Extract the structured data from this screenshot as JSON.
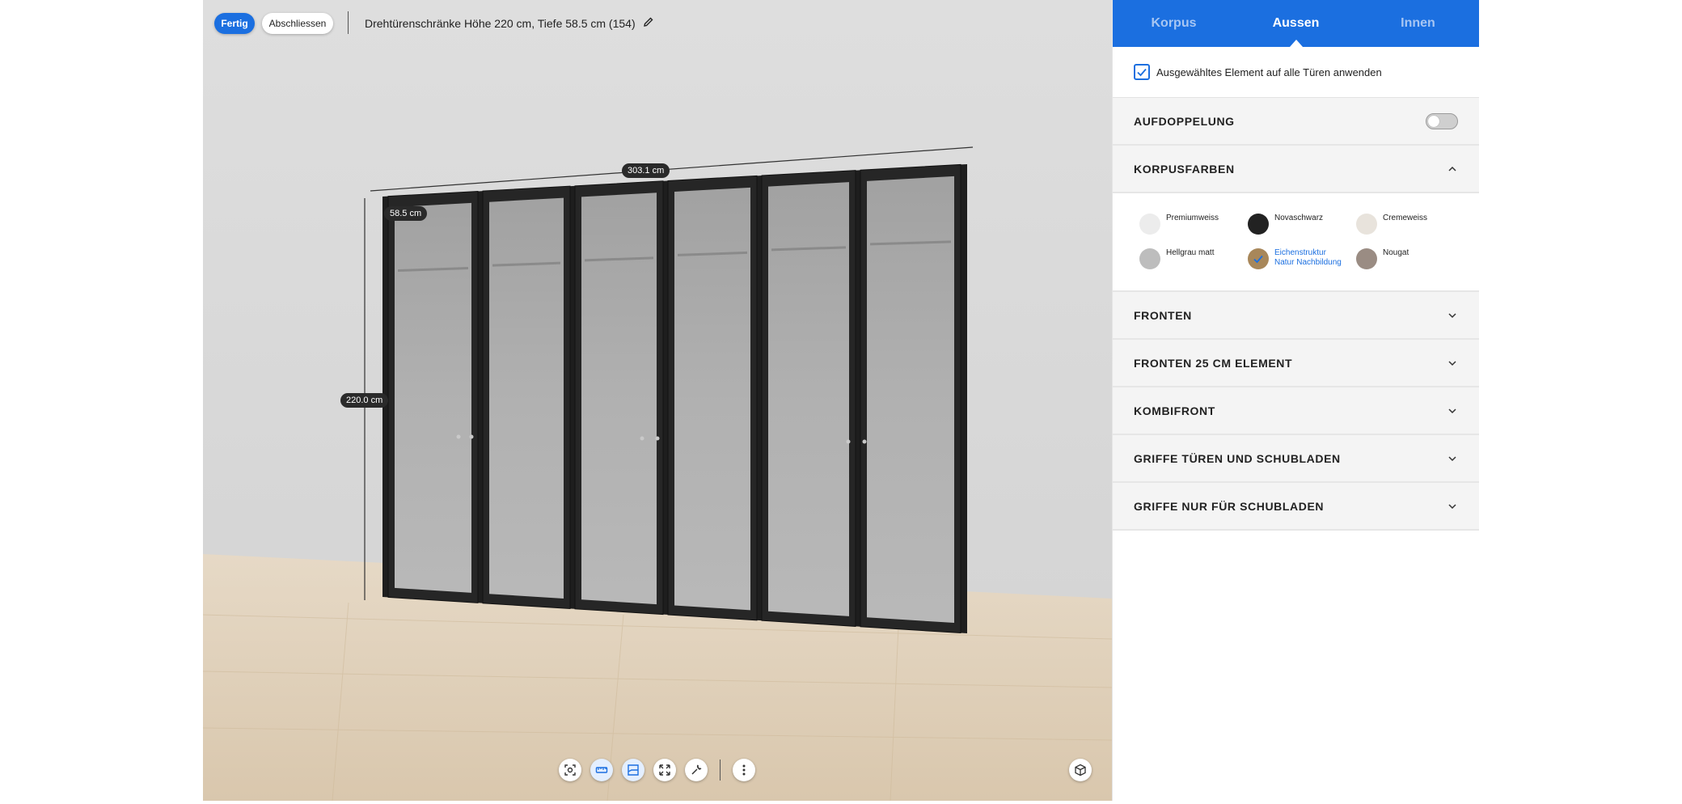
{
  "viewport": {
    "done_label": "Fertig",
    "close_label": "Abschliessen",
    "config_title": "Drehtürenschränke Höhe 220 cm, Tiefe 58.5 cm (154)",
    "dim_width": "303.1 cm",
    "dim_depth": "58.5 cm",
    "dim_height": "220.0 cm",
    "toolbar": [
      "screenshot-icon",
      "ruler-icon",
      "room-icon",
      "fullscreen-icon",
      "tools-icon",
      "more-icon",
      "view-cube-icon"
    ]
  },
  "panel": {
    "tabs": [
      {
        "label": "Korpus",
        "active": false
      },
      {
        "label": "Aussen",
        "active": true
      },
      {
        "label": "Innen",
        "active": false
      }
    ],
    "apply_all_label": "Ausgewähltes Element auf alle Türen anwenden",
    "apply_all_checked": true,
    "sections": {
      "aufdoppelung": "AUFDOPPELUNG",
      "korpusfarben": "KORPUSFARBEN",
      "fronten": "FRONTEN",
      "fronten25": "FRONTEN 25 CM ELEMENT",
      "kombifront": "KOMBIFRONT",
      "griffe_tueren": "GRIFFE TÜREN UND SCHUBLADEN",
      "griffe_schubladen": "GRIFFE NUR FÜR SCHUBLADEN"
    },
    "aufdoppelung_on": false,
    "colors": [
      {
        "name": "Premiumweiss",
        "color": "#ececec",
        "selected": false
      },
      {
        "name": "Novaschwarz",
        "color": "#222222",
        "selected": false
      },
      {
        "name": "Cremeweiss",
        "color": "#e8e3dc",
        "selected": false
      },
      {
        "name": "Hellgrau matt",
        "color": "#bdbdbd",
        "selected": false
      },
      {
        "name": "Eichenstruktur",
        "name2": "Natur Nachbildung",
        "color": "#a8875a",
        "selected": true
      },
      {
        "name": "Nougat",
        "color": "#9a8c83",
        "selected": false
      }
    ]
  }
}
